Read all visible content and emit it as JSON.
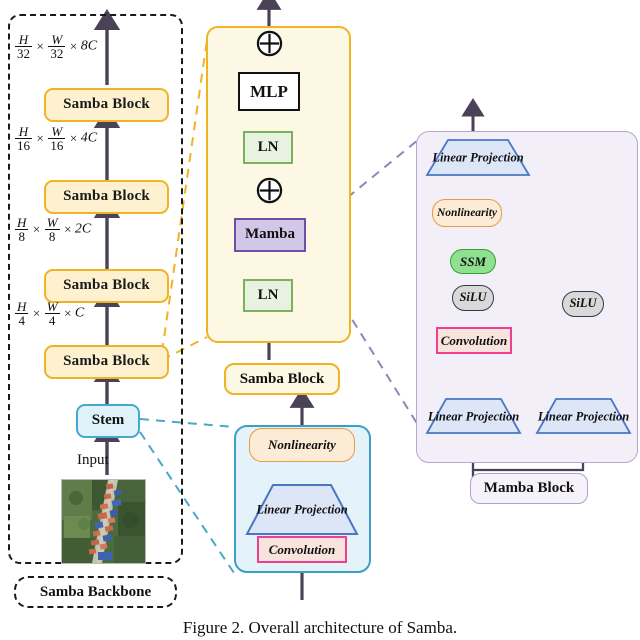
{
  "figure": {
    "caption": "Figure 2. Overall architecture of Samba."
  },
  "backbone": {
    "label": "Samba Backbone",
    "input_label": "Input",
    "stem_label": "Stem",
    "stages": [
      {
        "dim": {
          "h_den": "32",
          "w_den": "32",
          "channels": "8C"
        },
        "block_label": "Samba Block"
      },
      {
        "dim": {
          "h_den": "16",
          "w_den": "16",
          "channels": "4C"
        },
        "block_label": "Samba Block"
      },
      {
        "dim": {
          "h_den": "8",
          "w_den": "8",
          "channels": "2C"
        },
        "block_label": "Samba Block"
      },
      {
        "dim": {
          "h_den": "4",
          "w_den": "4",
          "channels": "C"
        },
        "block_label": "Samba Block"
      }
    ],
    "dim_numerator_h": "H",
    "dim_numerator_w": "W",
    "times_symbol": "×"
  },
  "samba_block_panel": {
    "label": "Samba Block",
    "nodes": {
      "add_top": "⊕",
      "mlp": "MLP",
      "ln_top": "LN",
      "add_bottom": "⊕",
      "mamba": "Mamba",
      "ln_bottom": "LN"
    }
  },
  "stem_panel": {
    "nodes": {
      "nonlinearity": "Nonlinearity",
      "linear_projection": "Linear Projection",
      "convolution": "Convolution"
    }
  },
  "mamba_block_panel": {
    "label": "Mamba Block",
    "nodes": {
      "linear_projection_out": "Linear Projection",
      "nonlinearity": "Nonlinearity",
      "ssm": "SSM",
      "silu_left": "SiLU",
      "convolution": "Convolution",
      "linear_projection_left": "Linear Projection",
      "silu_right": "SiLU",
      "linear_projection_right": "Linear Projection"
    }
  },
  "colors": {
    "samba_yellow_fill": "#fdf1cf",
    "samba_yellow_border": "#f0b323",
    "samba_panel_fill": "#fdf8e3",
    "stem_blue_fill": "#dff1f9",
    "stem_blue_border": "#47a8cd",
    "stem_panel_fill": "#e4f3fa",
    "mamba_purple_fill": "#d3c7e8",
    "mamba_purple_border": "#6f4fa5",
    "mamba_panel_fill": "#f2eff8",
    "ln_green_fill": "#e8f2e0",
    "ln_green_border": "#7cb05a",
    "ssm_green_fill": "#8fe08f",
    "nonlinearity_orange_fill": "#fdecd5",
    "nonlinearity_orange_border": "#e89a48",
    "convolution_pink_border": "#ef3f8f",
    "convolution_pink_fill": "#f8e4dd",
    "silu_gray_fill": "#d9d9d9",
    "linear_projection_fill": "#dce6f7",
    "linear_projection_border": "#4a76c4",
    "arrow_color": "#4a4257"
  }
}
